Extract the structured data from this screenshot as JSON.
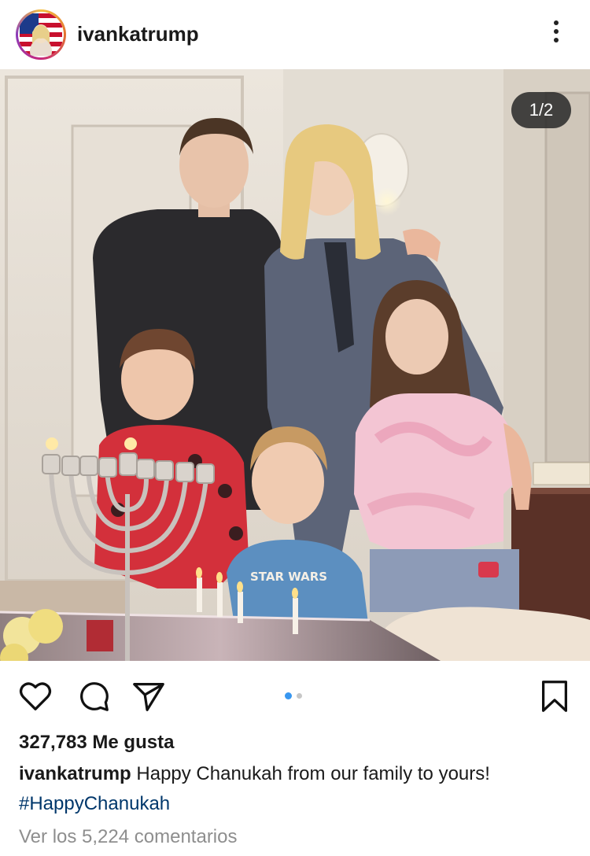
{
  "post": {
    "username": "ivankatrump",
    "counter": "1/2",
    "likes": "327,783 Me gusta",
    "caption_user": "ivankatrump",
    "caption_text": "Happy Chanukah from our family to yours!",
    "hashtag": "#HappyChanukah",
    "view_comments": "Ver los 5,224 comentarios"
  },
  "icons": {
    "more": "more-vertical-icon",
    "like": "heart-icon",
    "comment": "comment-icon",
    "share": "send-icon",
    "save": "bookmark-icon"
  },
  "carousel": {
    "index": 1,
    "total": 2,
    "active_color": "#3897f0",
    "inactive_color": "#c7c7c7"
  },
  "colors": {
    "link": "#00376b",
    "muted": "#8e8e8e"
  }
}
